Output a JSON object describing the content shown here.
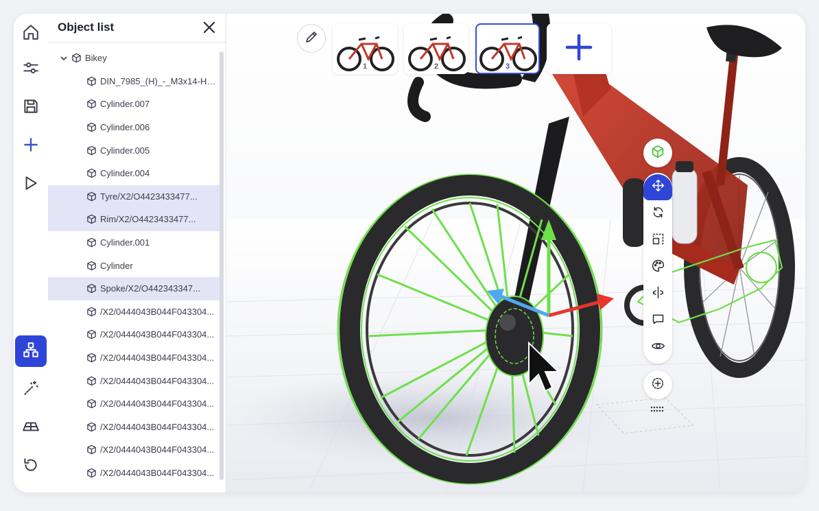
{
  "rail": {
    "items": [
      {
        "name": "home-icon"
      },
      {
        "name": "sliders-icon"
      },
      {
        "name": "save-icon"
      },
      {
        "name": "plus-icon"
      },
      {
        "name": "play-icon"
      },
      {
        "name": "hierarchy-icon",
        "active": true
      },
      {
        "name": "magic-wand-icon"
      },
      {
        "name": "floor-plane-icon"
      },
      {
        "name": "reset-icon"
      }
    ]
  },
  "panel": {
    "title": "Object list",
    "root": {
      "label": "Bikey",
      "expanded": true
    },
    "items": [
      {
        "label": "DIN_7985_(H)_-_M3x14-H_...",
        "selected": false
      },
      {
        "label": "Cylinder.007",
        "selected": false
      },
      {
        "label": "Cylinder.006",
        "selected": false
      },
      {
        "label": "Cylinder.005",
        "selected": false
      },
      {
        "label": "Cylinder.004",
        "selected": false
      },
      {
        "label": "Tyre/X2/O4423433477...",
        "selected": true
      },
      {
        "label": "Rim/X2/O4423433477...",
        "selected": true
      },
      {
        "label": "Cylinder.001",
        "selected": false
      },
      {
        "label": "Cylinder",
        "selected": false
      },
      {
        "label": "Spoke/X2/O442343347...",
        "selected": true
      },
      {
        "label": "/X2/0444043B044F043304...",
        "selected": false
      },
      {
        "label": "/X2/0444043B044F043304...",
        "selected": false
      },
      {
        "label": "/X2/0444043B044F043304...",
        "selected": false
      },
      {
        "label": "/X2/0444043B044F043304...",
        "selected": false
      },
      {
        "label": "/X2/0444043B044F043304...",
        "selected": false
      },
      {
        "label": "/X2/0444043B044F043304...",
        "selected": false
      },
      {
        "label": "/X2/0444043B044F043304...",
        "selected": false
      },
      {
        "label": "/X2/0444043B044F043304...",
        "selected": false
      }
    ]
  },
  "thumbnails": [
    {
      "number": "1",
      "active": false
    },
    {
      "number": "2",
      "active": false
    },
    {
      "number": "3",
      "active": true
    }
  ],
  "toolbar": {
    "top_icon": "object-cube-icon",
    "tools": [
      {
        "name": "move-icon",
        "active": true
      },
      {
        "name": "rotate-icon",
        "active": false
      },
      {
        "name": "scale-icon",
        "active": false
      },
      {
        "name": "palette-icon",
        "active": false
      },
      {
        "name": "mirror-icon",
        "active": false
      },
      {
        "name": "comment-icon",
        "active": false
      },
      {
        "name": "eye-icon",
        "active": false
      }
    ],
    "bottom_icon": "focus-center-icon"
  },
  "colors": {
    "accent": "#2f45d8",
    "selection_outline": "#6ee04a",
    "frame_red": "#c0392b",
    "selected_row_bg": "#e3e5f7"
  }
}
